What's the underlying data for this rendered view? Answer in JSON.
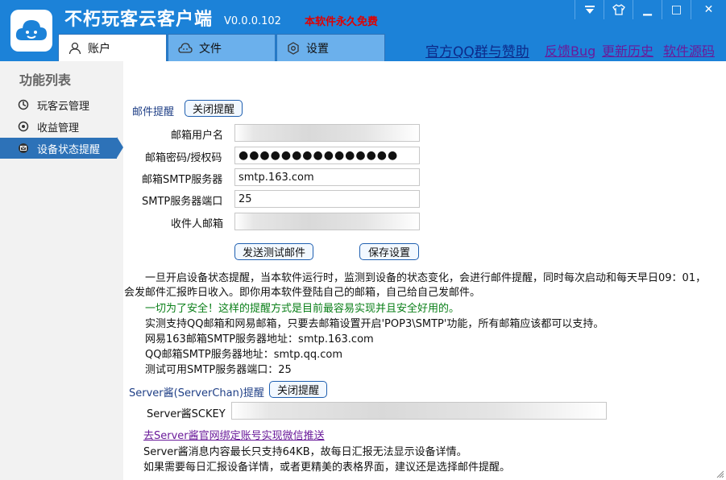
{
  "header": {
    "title": "不朽玩客云客户端",
    "version": "V0.0.0.102",
    "free_note": "本软件永久免费"
  },
  "window": {
    "menu_icon": "chevron-down-icon",
    "skin_icon": "shirt-icon",
    "minimize": "▁",
    "maximize": "□",
    "close": "✕"
  },
  "tabs": [
    {
      "label": "账户",
      "icon": "user-icon",
      "active": true
    },
    {
      "label": "文件",
      "icon": "cloud-icon",
      "active": false
    },
    {
      "label": "设置",
      "icon": "settings-icon",
      "active": false
    }
  ],
  "top_links": [
    "官方QQ群与赞助",
    "反馈Bug",
    "更新历史",
    "软件源码"
  ],
  "sidebar": {
    "title": "功能列表",
    "items": [
      {
        "label": "玩客云管理",
        "icon": "refresh-icon"
      },
      {
        "label": "收益管理",
        "icon": "target-icon"
      },
      {
        "label": "设备状态提醒",
        "icon": "mail-icon",
        "active": true
      }
    ]
  },
  "email": {
    "section_label": "邮件提醒",
    "toggle_label": "关闭提醒",
    "username_label": "邮箱用户名",
    "username_value": "",
    "password_label": "邮箱密码/授权码",
    "password_value": "●●●●●●●●●●●●●●●",
    "smtp_label": "邮箱SMTP服务器",
    "smtp_value": "smtp.163.com",
    "port_label": "SMTP服务器端口",
    "port_value": "25",
    "recipient_label": "收件人邮箱",
    "recipient_value": "",
    "send_test_label": "发送测试邮件",
    "save_label": "保存设置"
  },
  "info": {
    "p1_line1": "一旦开启设备状态提醒，当本软件运行时，监测到设备的状态变化，会进行邮件提醒，同时每次启动和每天早日09：01，",
    "p1_line2": "会发邮件汇报昨日收入。即你用本软件登陆自己的邮箱，自己给自己发邮件。",
    "safety": "一切为了安全！这样的提醒方式是目前最容易实现并且安全好用的。",
    "support": "实测支持QQ邮箱和网易邮箱，只要去邮箱设置开启'POP3\\SMTP'功能，所有邮箱应该都可以支持。",
    "smtp163": "网易163邮箱SMTP服务器地址：smtp.163.com",
    "smtpqq": "QQ邮箱SMTP服务器地址：smtp.qq.com",
    "port": "测试可用SMTP服务器端口：25"
  },
  "serverchan": {
    "section_label": "Server酱(ServerChan)提醒",
    "toggle_label": "关闭提醒",
    "sckey_label": "Server酱SCKEY",
    "sckey_value": "",
    "link": "去Server酱官网绑定账号实现微信推送",
    "note1": "Server酱消息内容最长只支持64KB，故每日汇报无法显示设备详情。",
    "note2": "如果需要每日汇报设备详情，或者更精美的表格界面，建议还是选择邮件提醒。"
  },
  "colors": {
    "titlebar": "#1c82d8",
    "sidebar_active": "#2d72b8",
    "free_note": "#e00000",
    "safety_text": "#0a7f18",
    "link": "#6a1b9a"
  }
}
